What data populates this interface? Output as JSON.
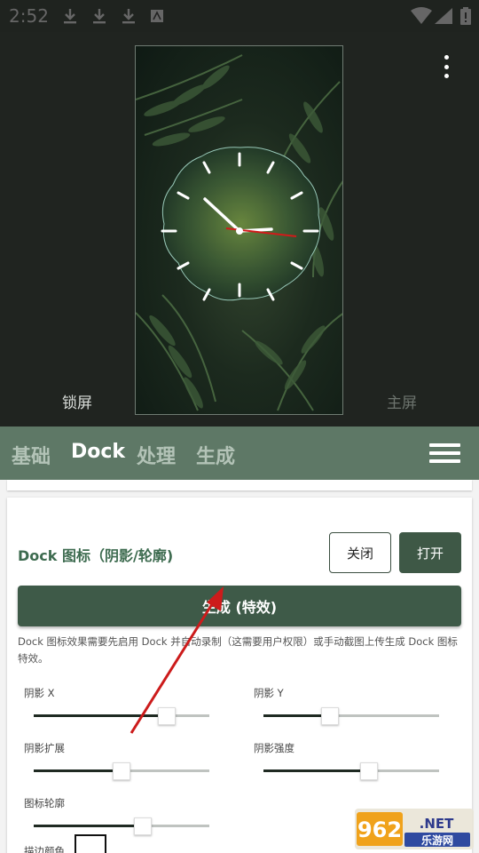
{
  "status_bar": {
    "time": "2:52"
  },
  "preview": {
    "lock_label": "锁屏",
    "home_label": "主屏"
  },
  "tabs": [
    {
      "label": "基础",
      "active": false
    },
    {
      "label": "Dock",
      "active": true
    },
    {
      "label": "处理",
      "active": false
    },
    {
      "label": "生成",
      "active": false
    }
  ],
  "dock_card": {
    "title": "Dock 图标（阴影/轮廓)",
    "close_label": "关闭",
    "open_label": "打开",
    "generate_label": "生成 (特效)",
    "description": "Dock 图标效果需要先启用 Dock 并自动录制（这需要用户权限）或手动截图上传生成 Dock 图标特效。",
    "sliders": [
      {
        "label": "阴影 X",
        "value": 0.76
      },
      {
        "label": "阴影 Y",
        "value": 0.38
      },
      {
        "label": "阴影扩展",
        "value": 0.5
      },
      {
        "label": "阴影强度",
        "value": 0.6
      },
      {
        "label": "图标轮廓",
        "value": 0.62
      }
    ],
    "stroke_color_label": "描边颜色"
  },
  "watermark": {
    "text_big": "962.NET",
    "text_small": "乐游网"
  },
  "colors": {
    "tabbar": "#5e7866",
    "accent": "#3e5a48",
    "title": "#3d6b4f",
    "arrow": "#cc1b1b"
  }
}
